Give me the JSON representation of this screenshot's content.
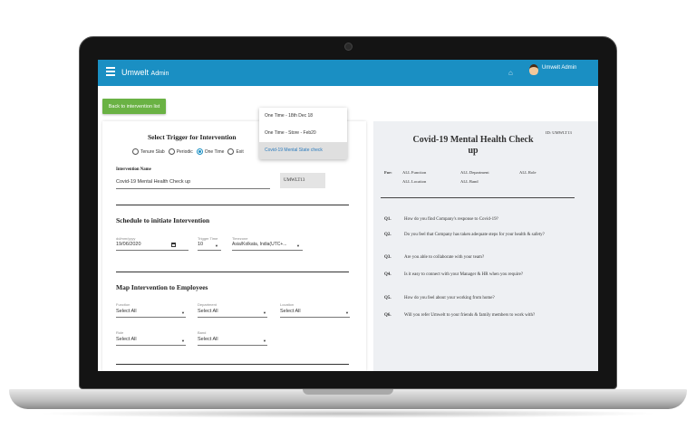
{
  "app": {
    "title": "Umwelt",
    "title_sub": "Admin",
    "user": "Umwelt Admin"
  },
  "back_button": "Back to intervention list",
  "trigger": {
    "heading": "Select Trigger for Intervention",
    "options": [
      "Tenure Slab",
      "Periodic",
      "One Time",
      "Exit"
    ],
    "selected": "One Time"
  },
  "intervention": {
    "name_label": "Intervention Name",
    "name_value": "Covid-19 Mental Health Check up",
    "code": "UMWLT13"
  },
  "dropdown": {
    "items": [
      "One Time - 18th Dec 18",
      "One Time - Store - Feb20",
      "Covid-19 Mental State check"
    ],
    "selected": "Covid-19 Mental State check"
  },
  "schedule": {
    "heading": "Schedule to initiate Intervention",
    "date_label": "dd/mm/yyyy",
    "date_value": "19/06/2020",
    "time_label": "Trigger Time",
    "time_value": "10",
    "tz_label": "Timezone",
    "tz_value": "Asia/Kolkata, India(UTC+..."
  },
  "map": {
    "heading": "Map Intervention to Employees",
    "fields": [
      {
        "label": "Function",
        "value": "Select All"
      },
      {
        "label": "Department",
        "value": "Select All"
      },
      {
        "label": "Location",
        "value": "Select All"
      },
      {
        "label": "Role",
        "value": "Select All"
      },
      {
        "label": "Band",
        "value": "Select All"
      }
    ]
  },
  "preview": {
    "title": "Covid-19 Mental Health Check up",
    "id": "ID: UMWLT13",
    "for_label": "For:",
    "for_items": [
      "ALL Function",
      "ALL Department",
      "ALL Role",
      "ALL Location",
      "ALL Band"
    ],
    "questions": [
      {
        "num": "Q1.",
        "text": "How do you find Company's response to Covid-19?"
      },
      {
        "num": "Q2.",
        "text": "Do you feel that Company has taken adequate steps for your health & safety?"
      },
      {
        "num": "Q3.",
        "text": "Are you able to collaborate with your team?"
      },
      {
        "num": "Q4.",
        "text": "Is it easy to connect with your Manager & HR when you require?"
      },
      {
        "num": "Q5.",
        "text": "How do you feel about your working from home?"
      },
      {
        "num": "Q6.",
        "text": "Will you refer Umwelt to your friends & family members to work with?"
      }
    ]
  }
}
